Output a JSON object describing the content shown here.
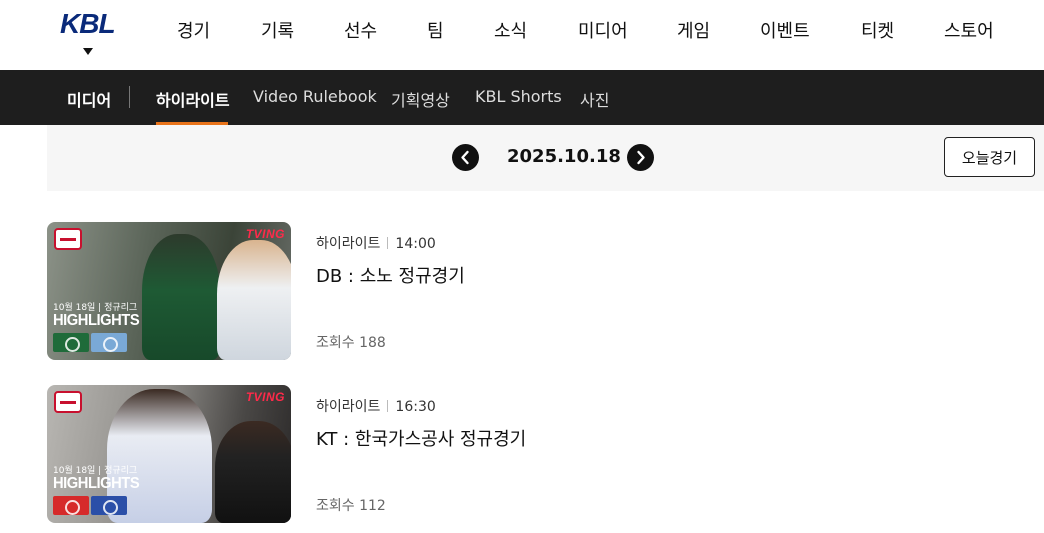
{
  "header": {
    "logo_text": "KBL",
    "nav": [
      {
        "label": "경기"
      },
      {
        "label": "기록"
      },
      {
        "label": "선수"
      },
      {
        "label": "팀"
      },
      {
        "label": "소식"
      },
      {
        "label": "미디어"
      },
      {
        "label": "게임"
      },
      {
        "label": "이벤트"
      },
      {
        "label": "티켓"
      },
      {
        "label": "스토어"
      }
    ]
  },
  "subnav": {
    "section": "미디어",
    "tabs": [
      {
        "label": "하이라이트",
        "active": true
      },
      {
        "label": "Video Rulebook"
      },
      {
        "label": "기획영상"
      },
      {
        "label": "KBL Shorts"
      },
      {
        "label": "사진"
      }
    ],
    "accent_color": "#e8731a"
  },
  "datebar": {
    "date": "2025.10.18",
    "today_button": "오늘경기",
    "prev_icon": "chevron-left-icon",
    "next_icon": "chevron-right-icon"
  },
  "videos": [
    {
      "category": "하이라이트",
      "time": "14:00",
      "title": "DB : 소노 정규경기",
      "views": "조회수 188",
      "thumb": {
        "brand": "TVING",
        "date_line": "10월 18일 | 정규리그",
        "label": "HIGHLIGHTS",
        "team_a_color": "#1f6b3a",
        "team_b_color": "#7aa9d6"
      }
    },
    {
      "category": "하이라이트",
      "time": "16:30",
      "title": "KT : 한국가스공사 정규경기",
      "views": "조회수 112",
      "thumb": {
        "brand": "TVING",
        "date_line": "10월 18일 | 정규리그",
        "label": "HIGHLIGHTS",
        "team_a_color": "#d62a2a",
        "team_b_color": "#2b4fa8"
      }
    }
  ]
}
